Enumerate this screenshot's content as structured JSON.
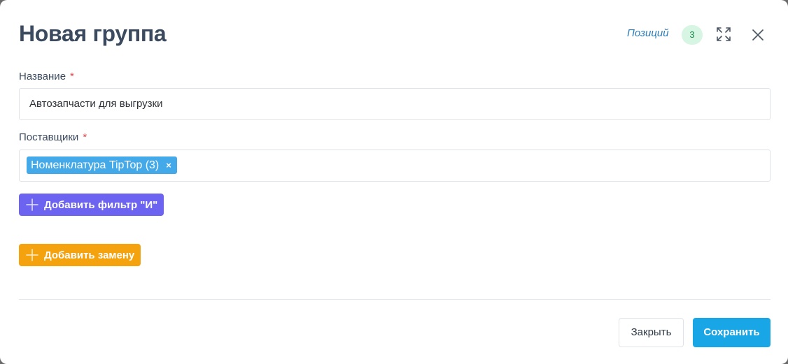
{
  "modal": {
    "title": "Новая группа",
    "positions_label": "Позиций",
    "positions_count": "3",
    "expand_icon": "expand-icon",
    "close_icon": "close-icon"
  },
  "form": {
    "name": {
      "label": "Название",
      "required_mark": "*",
      "value": "Автозапчасти для выгрузки"
    },
    "suppliers": {
      "label": "Поставщики",
      "required_mark": "*",
      "tags": [
        {
          "label": "Номенклатура TipTop (3)",
          "remove": "×"
        }
      ]
    }
  },
  "actions": {
    "add_and_filter": "Добавить фильтр \"И\"",
    "add_replacement": "Добавить замену"
  },
  "footer": {
    "close_label": "Закрыть",
    "save_label": "Сохранить"
  },
  "colors": {
    "accent_save": "#18a6e6",
    "and_filter_button": "#6c63f0",
    "replace_button": "#f5a20f",
    "tag": "#44a9e8",
    "badge_bg": "#d6f5e3",
    "required": "#e24a4a"
  }
}
